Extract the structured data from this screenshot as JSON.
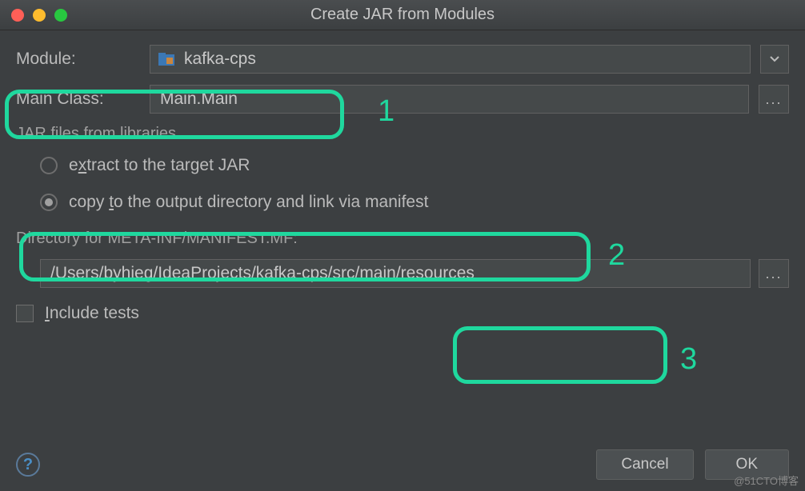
{
  "window": {
    "title": "Create JAR from Modules"
  },
  "module": {
    "label": "Module:",
    "value": "kafka-cps"
  },
  "mainClass": {
    "label": "Main Class:",
    "value": "Main.Main"
  },
  "libraries": {
    "section": "JAR files from libraries",
    "extract": {
      "prefix": "e",
      "mn": "x",
      "suffix": "tract to the target JAR"
    },
    "copy": {
      "prefix": "copy ",
      "mn": "t",
      "suffix": "o the output directory and link via manifest"
    }
  },
  "directory": {
    "label": "Directory for META-INF/MANIFEST.MF:",
    "value": "/Users/byhieg/IdeaProjects/kafka-cps/src/main/resources"
  },
  "includeTests": {
    "mn": "I",
    "suffix": "nclude tests"
  },
  "buttons": {
    "cancel": "Cancel",
    "ok": "OK",
    "help": "?"
  },
  "annotations": {
    "one": "1",
    "two": "2",
    "three": "3"
  },
  "watermark": "@51CTO博客"
}
